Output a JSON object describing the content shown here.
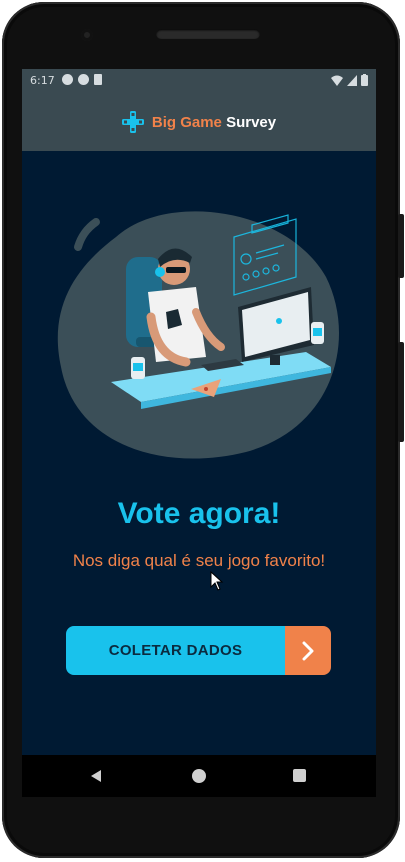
{
  "status_bar": {
    "time": "6:17",
    "icons": [
      "notification-a-icon",
      "notification-b-icon",
      "sd-card-icon"
    ],
    "right_icons": [
      "wifi-icon",
      "signal-icon",
      "battery-icon"
    ]
  },
  "header": {
    "brand_part1": "Big Game",
    "brand_part2": "Survey",
    "logo_icon": "gamepad-cross-icon"
  },
  "main": {
    "illustration": "gamer-at-computer-illustration",
    "title": "Vote agora!",
    "subtitle": "Nos diga qual é seu jogo favorito!",
    "cta_label": "COLETAR DADOS",
    "cta_icon": "chevron-right-icon"
  },
  "nav_bar": {
    "icons": [
      "back-icon",
      "home-icon",
      "recent-apps-icon"
    ]
  },
  "colors": {
    "screen_bg": "#001a33",
    "header_bg": "#3a4a51",
    "accent_blue": "#19c2ec",
    "accent_orange": "#f0824a"
  }
}
